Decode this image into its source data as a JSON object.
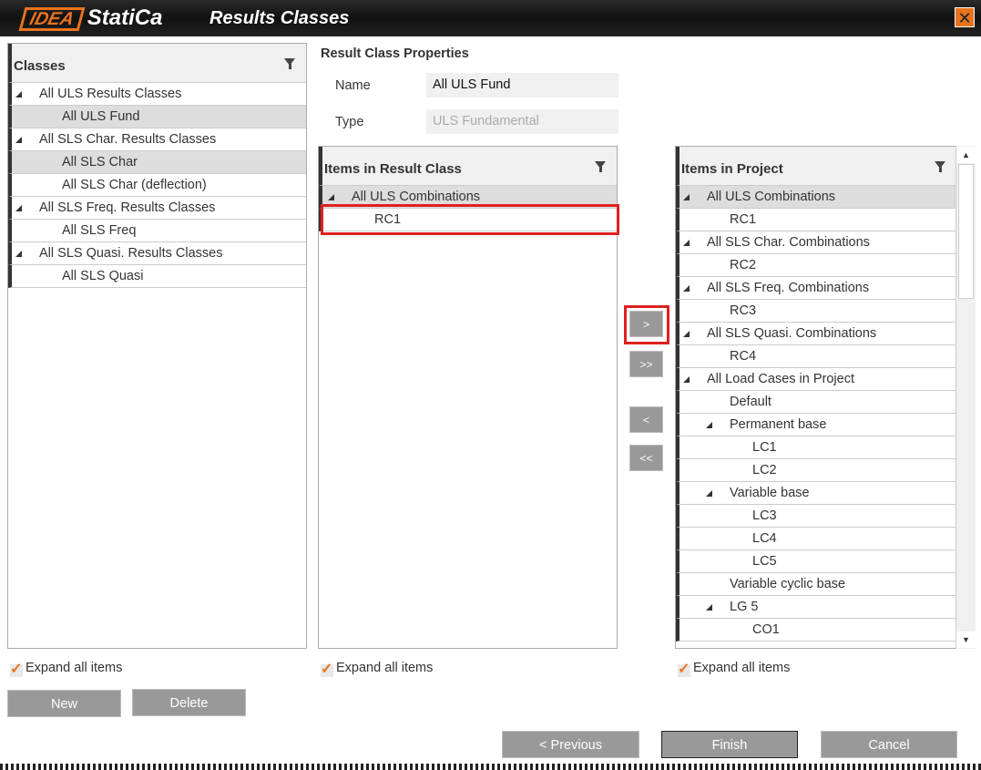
{
  "window": {
    "logo": "IDEA StatiCa",
    "logo_idea": "IDEA",
    "logo_rest": "StatiCa",
    "title": "Results Classes",
    "close": "✕"
  },
  "classes": {
    "header": "Classes",
    "rows": [
      {
        "label": "All ULS Results Classes",
        "level": 0,
        "expandable": true,
        "selected": false
      },
      {
        "label": "All ULS Fund",
        "level": 1,
        "expandable": false,
        "selected": true
      },
      {
        "label": "All SLS Char. Results Classes",
        "level": 0,
        "expandable": true,
        "selected": false
      },
      {
        "label": "All SLS Char",
        "level": 1,
        "expandable": false,
        "selected": true
      },
      {
        "label": "All SLS Char (deflection)",
        "level": 1,
        "expandable": false,
        "selected": false
      },
      {
        "label": "All SLS Freq. Results Classes",
        "level": 0,
        "expandable": true,
        "selected": false
      },
      {
        "label": "All SLS Freq",
        "level": 1,
        "expandable": false,
        "selected": false
      },
      {
        "label": "All SLS Quasi. Results Classes",
        "level": 0,
        "expandable": true,
        "selected": false
      },
      {
        "label": "All SLS Quasi",
        "level": 1,
        "expandable": false,
        "selected": false
      }
    ]
  },
  "properties": {
    "title": "Result Class Properties",
    "name_label": "Name",
    "name_value": "All ULS Fund",
    "type_label": "Type",
    "type_value": "ULS Fundamental"
  },
  "result_items": {
    "header": "Items in Result Class",
    "rows": [
      {
        "label": "All ULS Combinations",
        "level": 0,
        "expandable": true,
        "selected": true
      },
      {
        "label": "RC1",
        "level": 1,
        "expandable": false,
        "selected": false
      }
    ]
  },
  "project_items": {
    "header": "Items in Project",
    "rows": [
      {
        "label": "All ULS Combinations",
        "level": 0,
        "expandable": true,
        "selected": true
      },
      {
        "label": "RC1",
        "level": 1,
        "expandable": false,
        "selected": false
      },
      {
        "label": "All SLS Char. Combinations",
        "level": 0,
        "expandable": true,
        "selected": false
      },
      {
        "label": "RC2",
        "level": 1,
        "expandable": false,
        "selected": false
      },
      {
        "label": "All SLS Freq. Combinations",
        "level": 0,
        "expandable": true,
        "selected": false
      },
      {
        "label": "RC3",
        "level": 1,
        "expandable": false,
        "selected": false
      },
      {
        "label": "All SLS Quasi. Combinations",
        "level": 0,
        "expandable": true,
        "selected": false
      },
      {
        "label": "RC4",
        "level": 1,
        "expandable": false,
        "selected": false
      },
      {
        "label": "All Load Cases in Project",
        "level": 0,
        "expandable": true,
        "selected": false
      },
      {
        "label": "Default",
        "level": 1,
        "expandable": false,
        "selected": false
      },
      {
        "label": "Permanent base",
        "level": 1,
        "expandable": true,
        "selected": false
      },
      {
        "label": "LC1",
        "level": 2,
        "expandable": false,
        "selected": false
      },
      {
        "label": "LC2",
        "level": 2,
        "expandable": false,
        "selected": false
      },
      {
        "label": "Variable base",
        "level": 1,
        "expandable": true,
        "selected": false
      },
      {
        "label": "LC3",
        "level": 2,
        "expandable": false,
        "selected": false
      },
      {
        "label": "LC4",
        "level": 2,
        "expandable": false,
        "selected": false
      },
      {
        "label": "LC5",
        "level": 2,
        "expandable": false,
        "selected": false
      },
      {
        "label": "Variable cyclic base",
        "level": 1,
        "expandable": false,
        "selected": false
      },
      {
        "label": "LG 5",
        "level": 1,
        "expandable": true,
        "selected": false
      },
      {
        "label": "CO1",
        "level": 2,
        "expandable": false,
        "selected": false
      }
    ]
  },
  "move": {
    "add": ">",
    "add_all": ">>",
    "remove": "<",
    "remove_all": "<<"
  },
  "expand_all": "Expand all items",
  "buttons": {
    "new": "New",
    "delete": "Delete",
    "previous": "< Previous",
    "finish": "Finish",
    "cancel": "Cancel"
  },
  "scroll": {
    "up": "▲",
    "down": "▼"
  }
}
